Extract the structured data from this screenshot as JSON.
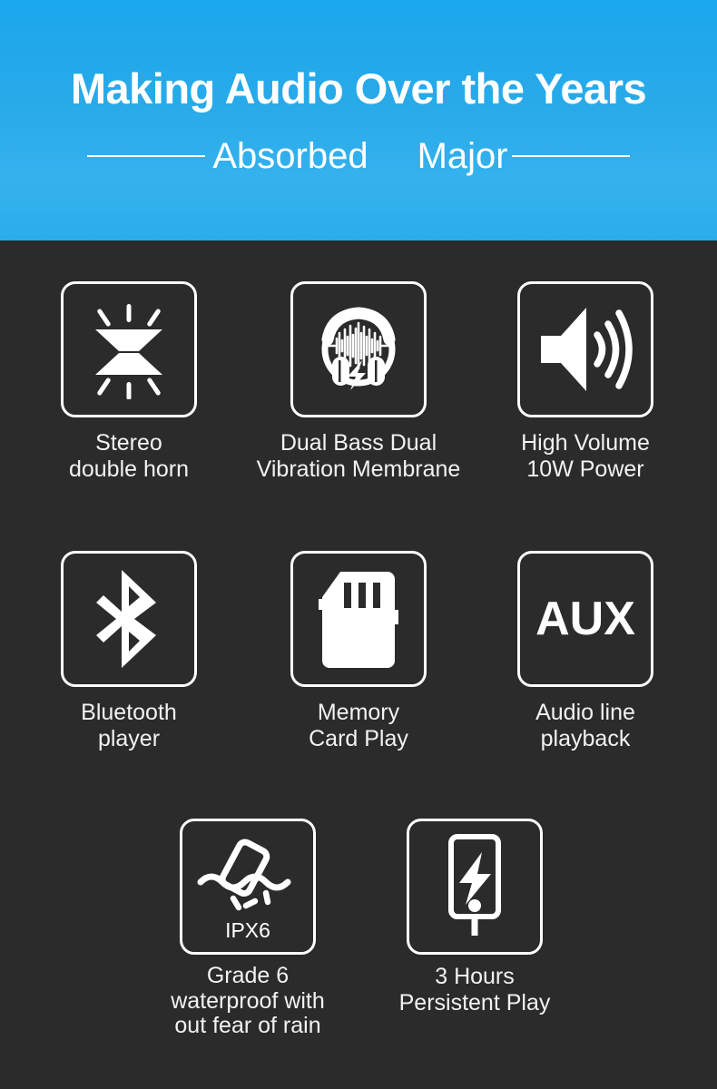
{
  "header": {
    "title": "Making Audio Over the Years",
    "subtitle_left": "Absorbed",
    "subtitle_right": "Major",
    "background_color": "#29aae9",
    "text_color": "#ffffff"
  },
  "theme": {
    "page_background": "#2b2b2b",
    "icon_stroke": "#ffffff",
    "label_color": "#f2f2f2"
  },
  "features": [
    {
      "icon": "stereo-double-horn-icon",
      "label": "Stereo\ndouble horn"
    },
    {
      "icon": "headphones-waveform-bass-icon",
      "label": "Dual Bass Dual\nVibration Membrane"
    },
    {
      "icon": "speaker-volume-icon",
      "label": "High Volume\n10W Power"
    },
    {
      "icon": "bluetooth-icon",
      "label": "Bluetooth\nplayer"
    },
    {
      "icon": "sd-memory-card-icon",
      "label": "Memory\nCard Play"
    },
    {
      "icon": "aux-text-icon",
      "label": "Audio line\nplayback",
      "icon_text": "AUX"
    },
    {
      "icon": "waterproof-ipx6-icon",
      "label": "Grade 6\nwaterproof with\nout fear of rain",
      "icon_text": "IPX6"
    },
    {
      "icon": "phone-charging-bolt-icon",
      "label": "3 Hours\nPersistent Play"
    }
  ]
}
